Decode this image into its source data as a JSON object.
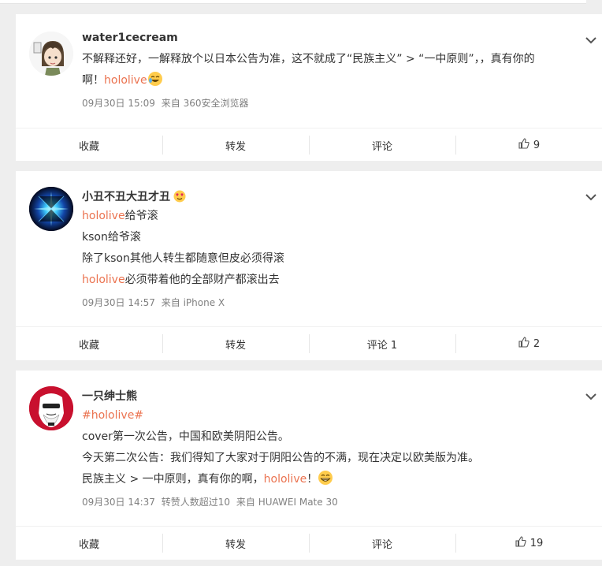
{
  "posts": [
    {
      "username": "water1cecream",
      "lines": [
        [
          "不解释还好，一解释放个以日本公告为准，这不就成了“民族主义” > “一中原则”，，真有你的"
        ],
        [
          "啊！",
          "hololive",
          ""
        ]
      ],
      "time": "09月30日 15:09",
      "source": "来自 360安全浏览器",
      "actions": {
        "fav": "收藏",
        "repost": "转发",
        "comment": "评论",
        "likes": "9"
      }
    },
    {
      "username": "小丑不丑大丑才丑",
      "lines": [
        [
          "",
          "hololive",
          "给爷滚"
        ],
        [
          "kson给爷滚"
        ],
        [
          "除了kson其他人转生都随意但皮必须得滚"
        ],
        [
          "",
          "hololive",
          "必须带着他的全部财产都滚出去"
        ]
      ],
      "time": "09月30日 14:57",
      "source": "来自 iPhone X",
      "actions": {
        "fav": "收藏",
        "repost": "转发",
        "comment": "评论 1",
        "likes": "2"
      }
    },
    {
      "username": "一只绅士熊",
      "topic": "#hololive#",
      "lines": [
        [
          "cover第一次公告，中国和欧美阴阳公告。"
        ],
        [
          "今天第二次公告：我们得知了大家对于阴阳公告的不满，现在决定以欧美版为准。"
        ],
        [
          "民族主义 > 一中原则，真有你的啊，",
          "hololive",
          "！"
        ]
      ],
      "time": "09月30日 14:37",
      "extra": "转赞人数超过10",
      "source": "来自 HUAWEI Mate 30",
      "actions": {
        "fav": "收藏",
        "repost": "转发",
        "comment": "评论",
        "likes": "19"
      }
    }
  ],
  "icons": {
    "chevron": "chevron-down-icon",
    "like": "thumbs-up-icon"
  },
  "colors": {
    "link": "#eb7350",
    "meta": "#808080",
    "background": "#eeeeee"
  }
}
